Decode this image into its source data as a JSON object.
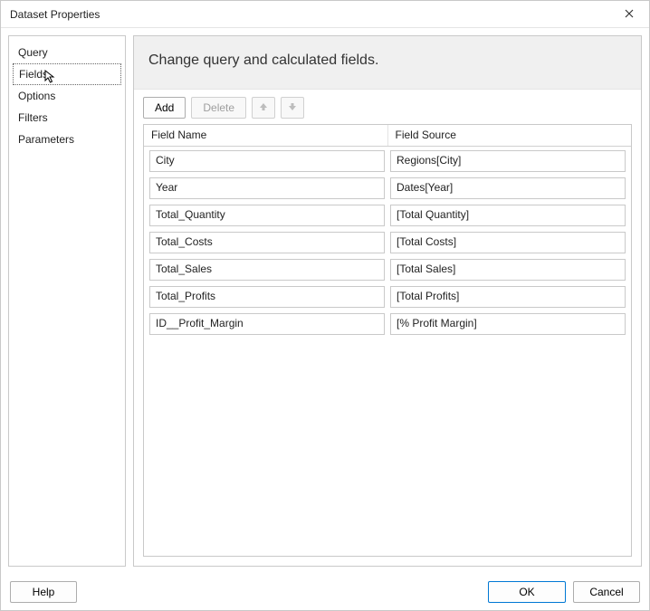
{
  "window": {
    "title": "Dataset Properties"
  },
  "sidebar": {
    "items": [
      {
        "label": "Query"
      },
      {
        "label": "Fields"
      },
      {
        "label": "Options"
      },
      {
        "label": "Filters"
      },
      {
        "label": "Parameters"
      }
    ],
    "selected_index": 1
  },
  "main": {
    "heading": "Change query and calculated fields.",
    "toolbar": {
      "add_label": "Add",
      "delete_label": "Delete"
    },
    "columns": {
      "name": "Field Name",
      "source": "Field Source"
    },
    "rows": [
      {
        "name": "City",
        "source": "Regions[City]"
      },
      {
        "name": "Year",
        "source": "Dates[Year]"
      },
      {
        "name": "Total_Quantity",
        "source": "[Total Quantity]"
      },
      {
        "name": "Total_Costs",
        "source": "[Total Costs]"
      },
      {
        "name": "Total_Sales",
        "source": "[Total Sales]"
      },
      {
        "name": "Total_Profits",
        "source": "[Total Profits]"
      },
      {
        "name": "ID__Profit_Margin",
        "source": "[% Profit Margin]"
      }
    ]
  },
  "footer": {
    "help_label": "Help",
    "ok_label": "OK",
    "cancel_label": "Cancel"
  }
}
